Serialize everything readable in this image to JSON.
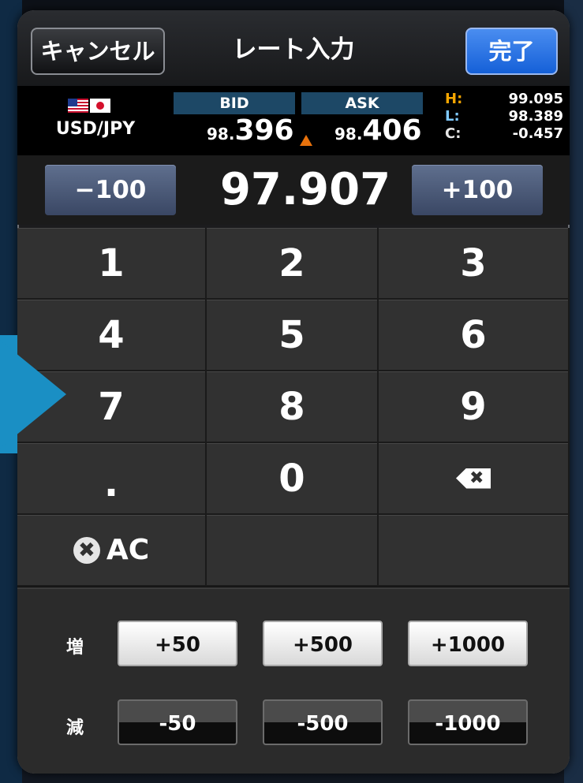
{
  "header": {
    "cancel_label": "キャンセル",
    "title": "レート入力",
    "done_label": "完了"
  },
  "quote": {
    "pair": "USD/JPY",
    "bid_label": "BID",
    "ask_label": "ASK",
    "bid_small": "98.",
    "bid_big": "396",
    "ask_small": "98.",
    "ask_big": "406",
    "high_key": "H:",
    "high_value": "99.095",
    "low_key": "L:",
    "low_value": "98.389",
    "change_key": "C:",
    "change_value": "-0.457"
  },
  "input": {
    "minus100_label": "−100",
    "plus100_label": "+100",
    "rate_value": "97.907"
  },
  "keypad": {
    "k1": "1",
    "k2": "2",
    "k3": "3",
    "k4": "4",
    "k5": "5",
    "k6": "6",
    "k7": "7",
    "k8": "8",
    "k9": "9",
    "dot": ".",
    "k0": "0",
    "ac_label": "AC",
    "ac_icon": "✖",
    "backspace_icon": "✖"
  },
  "steps": {
    "increase_label": "増",
    "decrease_label": "減",
    "inc_50": "+50",
    "inc_500": "+500",
    "inc_1000": "+1000",
    "dec_50": "-50",
    "dec_500": "-500",
    "dec_1000": "-1000"
  },
  "colors": {
    "done_button": "#1560d8",
    "adjust_button": "#3a4764",
    "high_key": "#f5a600",
    "low_key": "#7fc9ff",
    "up_triangle": "#e8720c",
    "pointer_arrow": "#1a8fc4"
  }
}
